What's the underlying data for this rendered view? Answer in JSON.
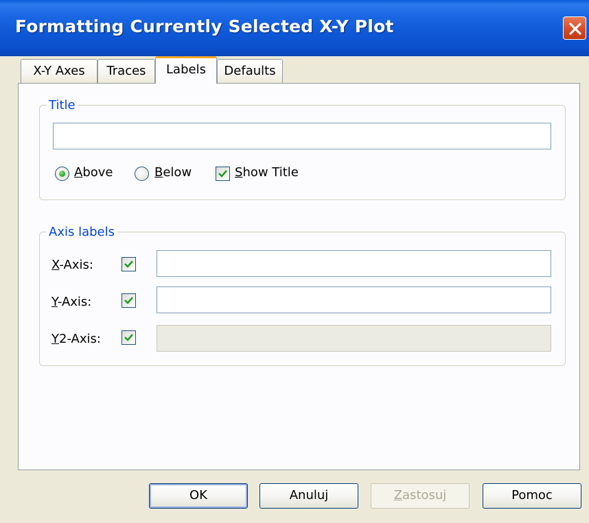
{
  "window": {
    "title": "Formatting Currently Selected X-Y Plot"
  },
  "tabs": [
    {
      "label": "X-Y Axes",
      "active": false
    },
    {
      "label": "Traces",
      "active": false
    },
    {
      "label": "Labels",
      "active": true
    },
    {
      "label": "Defaults",
      "active": false
    }
  ],
  "title_group": {
    "legend": "Title",
    "title_value": "",
    "position": {
      "above": {
        "mnemonic": "A",
        "rest": "bove",
        "selected": true
      },
      "below": {
        "mnemonic": "B",
        "rest": "elow",
        "selected": false
      }
    },
    "show_title": {
      "mnemonic": "S",
      "rest": "how Title",
      "checked": true
    }
  },
  "axis_group": {
    "legend": "Axis labels",
    "x_axis": {
      "mnemonic": "X",
      "rest": "-Axis:",
      "checked": true,
      "value": ""
    },
    "y_axis": {
      "mnemonic": "Y",
      "rest": "-Axis:",
      "checked": true,
      "value": ""
    },
    "y2_axis": {
      "mnemonic": "Y",
      "rest": "2-Axis:",
      "checked": true,
      "value": "",
      "disabled": true
    }
  },
  "buttons": {
    "ok": "OK",
    "cancel": "Anuluj",
    "apply": {
      "mnemonic": "Z",
      "rest": "astosuj",
      "disabled": true
    },
    "help": "Pomoc"
  }
}
